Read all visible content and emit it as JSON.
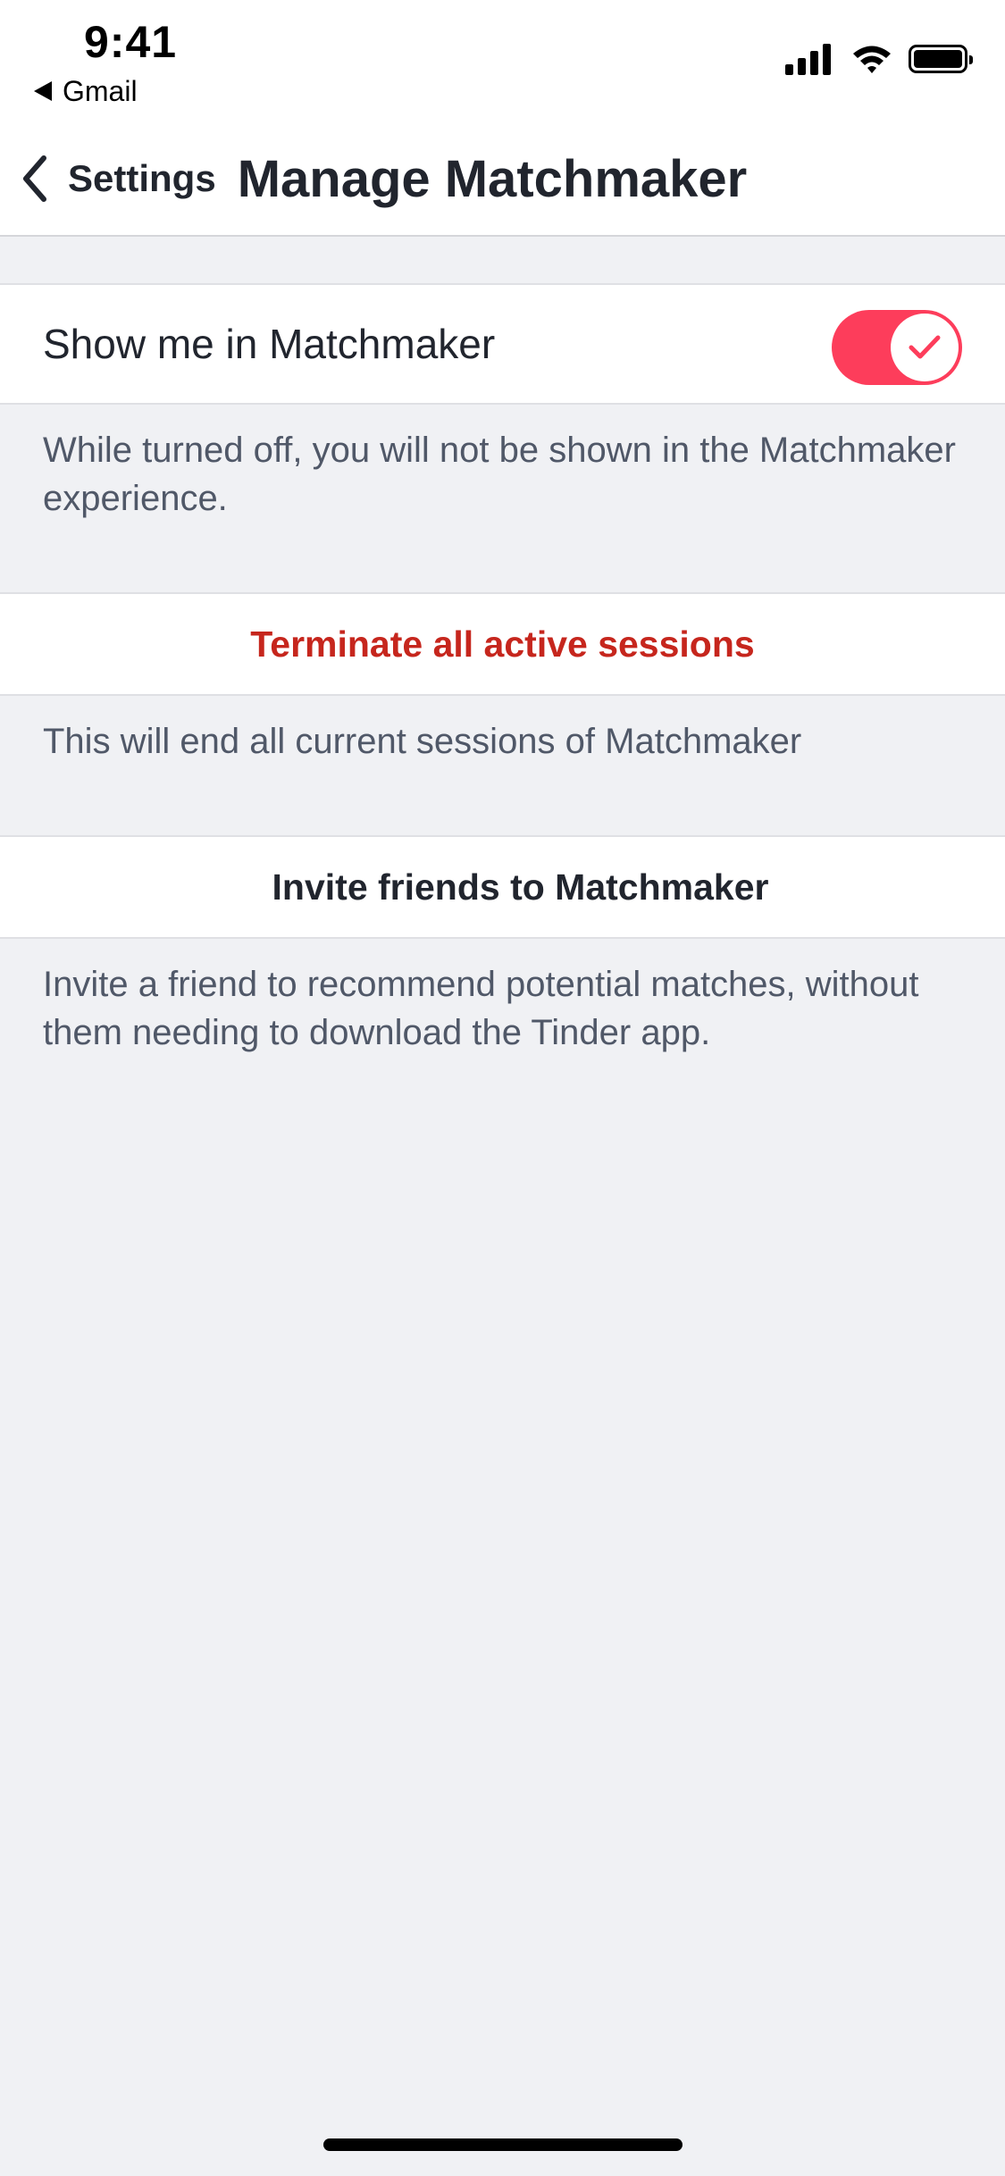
{
  "status_bar": {
    "time": "9:41",
    "back_app": "Gmail",
    "icons": [
      "cellular-signal-icon",
      "wifi-icon",
      "battery-icon"
    ]
  },
  "nav": {
    "back_label": "Settings",
    "back_icon": "chevron-left-icon",
    "title": "Manage Matchmaker"
  },
  "show_in_matchmaker": {
    "label": "Show me in Matchmaker",
    "enabled": true,
    "toggle_icon": "checkmark-icon",
    "description": "While turned off, you will not be shown in the Matchmaker experience."
  },
  "terminate_sessions": {
    "label": "Terminate all active sessions",
    "description": "This will end all current sessions of Matchmaker"
  },
  "invite_friends": {
    "label": "Invite friends to Matchmaker",
    "description": "Invite a friend to recommend potential matches, without them needing to download the Tinder app."
  },
  "colors": {
    "accent": "#fd3d5b",
    "destructive_text": "#c6261d",
    "primary_text": "#21252e",
    "secondary_text": "#505868",
    "background": "#f0f1f4"
  }
}
